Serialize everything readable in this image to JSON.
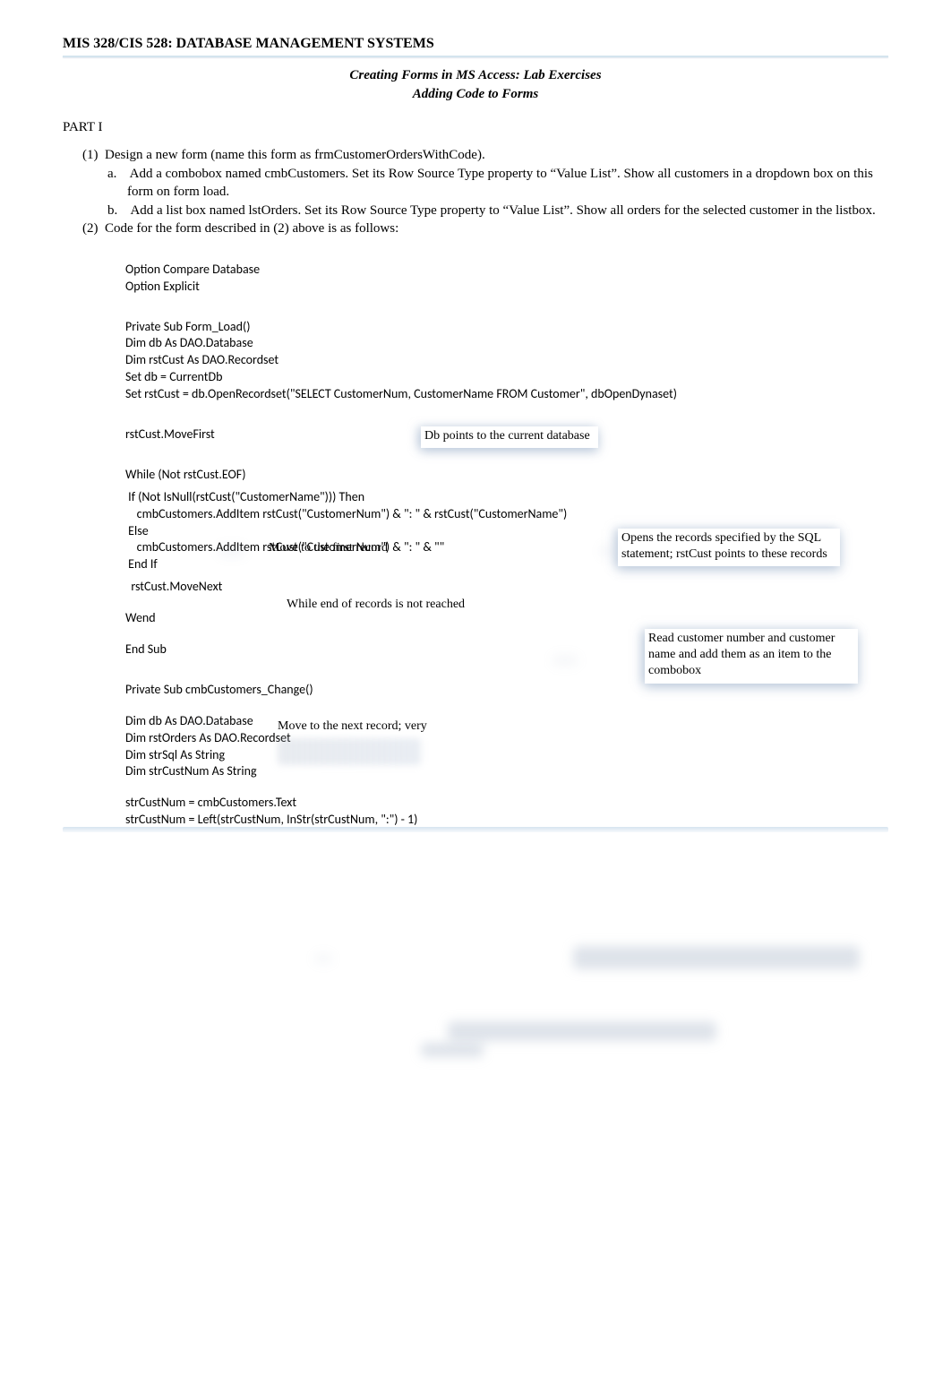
{
  "header": {
    "title": "MIS 328/CIS 528: DATABASE MANAGEMENT SYSTEMS",
    "subtitle_line1": "Creating Forms in MS Access:  Lab Exercises",
    "subtitle_line2": "Adding Code to Forms"
  },
  "part_label": "PART I",
  "item1": {
    "num": "(1)",
    "text": "Design a new form (name this form as  frmCustomerOrdersWithCode).",
    "a_label": "a.",
    "a_text": "Add a combobox named cmbCustomers. Set its Row Source Type property to “Value List”. Show all customers in a dropdown box on this form on form load.",
    "b_label": "b.",
    "b_text": "Add a list box named lstOrders. Set its Row Source Type property to “Value List”. Show all orders for the selected customer in the listbox."
  },
  "item2": {
    "num": "(2)",
    "text": "Code for the form described in (2)  above is as follows:"
  },
  "code": {
    "l1": "Option Compare Database",
    "l2": "Option Explicit",
    "l3": "Private Sub Form_Load()",
    "l4": "Dim db As DAO.Database",
    "l5": "Dim rstCust As DAO.Recordset",
    "l6": "Set db = CurrentDb",
    "l7": "Set rstCust = db.OpenRecordset(\"SELECT CustomerNum, CustomerName FROM Customer\", dbOpenDynaset)",
    "l8": "rstCust.MoveFirst",
    "l9": "While (Not rstCust.EOF)",
    "l10": " If (Not IsNull(rstCust(\"CustomerName\"))) Then",
    "l11": "    cmbCustomers.AddItem rstCust(\"CustomerNum\") & \": \" & rstCust(\"CustomerName\")",
    "l12": " Else",
    "l13": "    cmbCustomers.AddItem rstCust(\"CustomerNum\") & \": \" & \"\"",
    "l14": " End If",
    "l15": "  rstCust.MoveNext",
    "l16": "Wend",
    "l17": "End Sub",
    "l18": "Private Sub cmbCustomers_Change()",
    "l19": "Dim db As DAO.Database",
    "l20": "Dim rstOrders As DAO.Recordset",
    "l21": "Dim strSql As String",
    "l22": "Dim strCustNum As String",
    "l23": "strCustNum = cmbCustomers.Text",
    "l24": "strCustNum = Left(strCustNum, InStr(strCustNum, \":\") - 1)"
  },
  "callouts": {
    "db": "Db points to the current database",
    "movefirst": "Move to the first record",
    "opens": "Opens the records specified by the SQL statement; rstCust points to these records",
    "while": "While end of records is not reached",
    "read": "Read customer number and customer name and add them as an item to the combobox",
    "movenext": "Move to the next record; very"
  }
}
